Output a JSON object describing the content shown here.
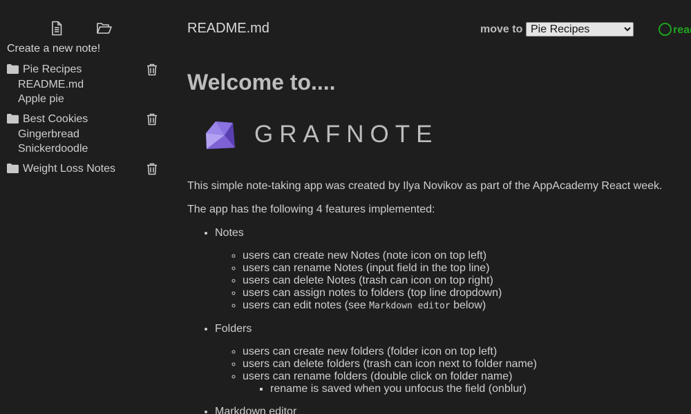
{
  "sidebar": {
    "icons": {
      "new_note": "file-icon",
      "new_folder": "folder-open-icon"
    },
    "new_note_label": "Create a new note!",
    "folders": [
      {
        "name": "Pie Recipes",
        "notes": [
          "README.md",
          "Apple pie"
        ]
      },
      {
        "name": "Best Cookies",
        "notes": [
          "Gingerbread",
          "Snickerdoodle"
        ]
      },
      {
        "name": "Weight Loss Notes",
        "notes": []
      }
    ]
  },
  "header": {
    "note_title": "README.md",
    "move_to_label": "move to",
    "move_to_selected": "Pie Recipes",
    "status_text": "ready"
  },
  "content": {
    "heading": "Welcome to....",
    "logo_text": "GRAFNOTE",
    "para1": "This simple note-taking app was created by Ilya Novikov as part of the AppAcademy React week.",
    "para2": "The app has the following 4 features implemented:",
    "features": [
      {
        "title": "Notes",
        "items": [
          {
            "text": "users can create new Notes (note icon on top left)"
          },
          {
            "text": "users can rename Notes (input field in the top line)"
          },
          {
            "text": "users can delete Notes (trash can icon on top right)"
          },
          {
            "text": "users can assign notes to folders (top line dropdown)"
          },
          {
            "text_before": "users can edit notes (see ",
            "code": "Markdown editor",
            "text_after": " below)"
          }
        ]
      },
      {
        "title": "Folders",
        "items": [
          {
            "text": "users can create new folders (folder icon on top left)"
          },
          {
            "text": "users can delete folders (trash can icon next to folder name)"
          },
          {
            "text": "users can rename folders (double click on folder name)",
            "sub": [
              "rename is saved when you unfocus the field (onblur)"
            ]
          }
        ]
      },
      {
        "title": "Markdown editor"
      }
    ]
  },
  "colors": {
    "background": "#1e1e1e",
    "text": "#cfcfcf",
    "status_green": "#1fa31f",
    "logo_purple": "#7b5fd6"
  }
}
